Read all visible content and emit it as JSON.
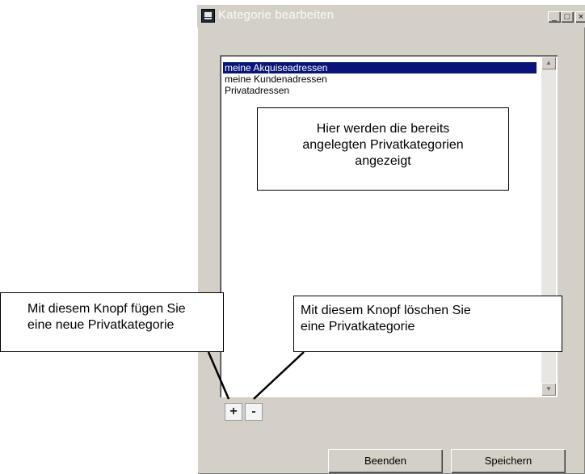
{
  "window": {
    "title": "Kategorie bearbeiten",
    "controls": {
      "minimize": "_",
      "maximize": "□",
      "close": "×"
    }
  },
  "list": {
    "items": [
      "meine Akquiseadressen",
      "meine Kundenadressen",
      "Privatadressen"
    ],
    "selected_index": 0
  },
  "buttons": {
    "add": "+",
    "remove": "-",
    "close_label": "Beenden",
    "save_label": "Speichern"
  },
  "annotations": {
    "list_note_line1": "Hier werden die bereits",
    "list_note_line2": "angelegten Privatkategorien",
    "list_note_line3": "angezeigt",
    "add_note_line1": "Mit diesem Knopf fügen Sie",
    "add_note_line2": "eine neue Privatkategorie",
    "delete_note_line1": "Mit diesem Knopf löschen Sie",
    "delete_note_line2": "eine Privatkategorie"
  },
  "colors": {
    "window_bg": "#d4d0c8",
    "selection_bg": "#0a1478",
    "selection_text": "#ffffff"
  }
}
